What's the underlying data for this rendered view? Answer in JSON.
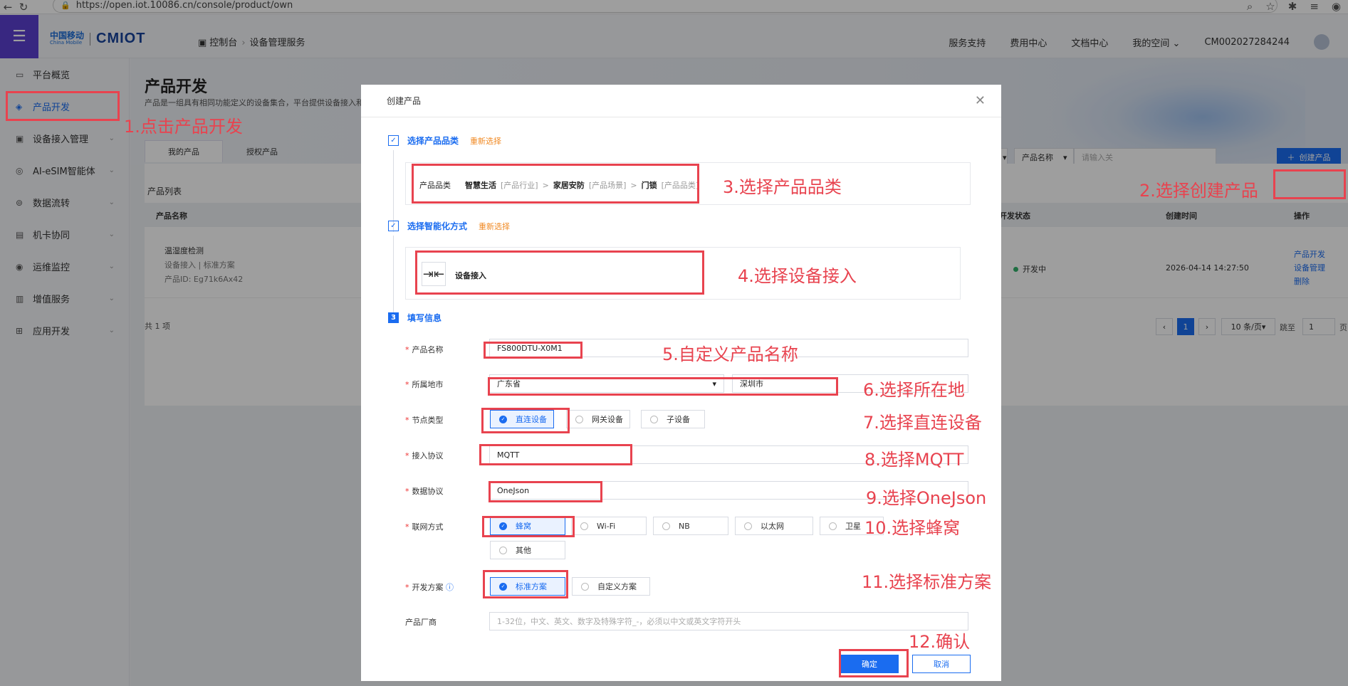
{
  "browser": {
    "url": "https://open.iot.10086.cn/console/product/own"
  },
  "topnav": {
    "logo_cn": "中国移动",
    "logo_en": "China Mobile",
    "logo_brand": "CMIOT",
    "breadcrumb_home": "控制台",
    "breadcrumb_current": "设备管理服务",
    "links": [
      "服务支持",
      "费用中心",
      "文档中心",
      "我的空间"
    ],
    "account": "CM002027284244"
  },
  "sidebar": {
    "items": [
      {
        "label": "平台概览",
        "icon": "monitor-icon"
      },
      {
        "label": "产品开发",
        "icon": "cube-icon"
      },
      {
        "label": "设备接入管理",
        "icon": "device-icon"
      },
      {
        "label": "AI-eSIM智能体",
        "icon": "ai-icon"
      },
      {
        "label": "数据流转",
        "icon": "flow-icon"
      },
      {
        "label": "机卡协同",
        "icon": "card-icon"
      },
      {
        "label": "运维监控",
        "icon": "monitor-eye-icon"
      },
      {
        "label": "增值服务",
        "icon": "chart-icon"
      },
      {
        "label": "应用开发",
        "icon": "grid-icon"
      }
    ]
  },
  "page": {
    "title": "产品开发",
    "desc": "产品是一组具有相同功能定义的设备集合，平台提供设备接入和",
    "tabs": [
      "我的产品",
      "授权产品"
    ],
    "list_title": "产品列表",
    "filter_field": "产品名称",
    "filter_placeholder": "请输入关",
    "create_btn": "创建产品",
    "columns": [
      "产品名称",
      "开发状态",
      "创建时间",
      "操作"
    ],
    "row": {
      "name": "温湿度检测",
      "meta": "设备接入 | 标准方案",
      "id": "产品ID:  Eg71k6Ax42",
      "status": "开发中",
      "created": "2026-04-14 14:27:50",
      "ops": [
        "产品开发",
        "设备管理",
        "删除"
      ]
    },
    "total": "共 1 项",
    "pager": {
      "current": "1",
      "size": "10 条/页",
      "goto": "跳至",
      "goto_val": "1",
      "page_unit": "页"
    }
  },
  "modal": {
    "title": "创建产品",
    "step1": {
      "title": "选择产品品类",
      "reselect": "重新选择",
      "category_label": "产品品类",
      "path": [
        {
          "name": "智慧生活",
          "type": "[产品行业]"
        },
        {
          "name": "家居安防",
          "type": "[产品场景]"
        },
        {
          "name": "门锁",
          "type": "[产品品类]"
        }
      ]
    },
    "step2": {
      "title": "选择智能化方式",
      "reselect": "重新选择",
      "option": "设备接入"
    },
    "step3": {
      "num": "3",
      "title": "填写信息"
    },
    "fields": {
      "name": {
        "label": "产品名称",
        "value": "FS800DTU-X0M1"
      },
      "city": {
        "label": "所属地市",
        "province": "广东省",
        "city": "深圳市"
      },
      "node": {
        "label": "节点类型",
        "options": [
          "直连设备",
          "网关设备",
          "子设备"
        ]
      },
      "protocol": {
        "label": "接入协议",
        "value": "MQTT"
      },
      "data": {
        "label": "数据协议",
        "value": "OneJson"
      },
      "network": {
        "label": "联网方式",
        "options": [
          "蜂窝",
          "Wi-Fi",
          "NB",
          "以太网",
          "卫星",
          "其他"
        ]
      },
      "plan": {
        "label": "开发方案",
        "options": [
          "标准方案",
          "自定义方案"
        ]
      },
      "vendor": {
        "label": "产品厂商",
        "placeholder": "1-32位，中文、英文、数字及特殊字符_-，必须以中文或英文字符开头"
      }
    },
    "ok": "确定",
    "cancel": "取消"
  },
  "annotations": [
    "1.点击产品开发",
    "2.选择创建产品",
    "3.选择产品品类",
    "4.选择设备接入",
    "5.自定义产品名称",
    "6.选择所在地",
    "7.选择直连设备",
    "8.选择MQTT",
    "9.选择OneJson",
    "10.选择蜂窝",
    "11.选择标准方案",
    "12.确认"
  ],
  "colors": {
    "primary": "#1a6cf0",
    "annotation": "#e8434f",
    "menu": "#5b3fd1",
    "reselect": "#f08a24"
  }
}
